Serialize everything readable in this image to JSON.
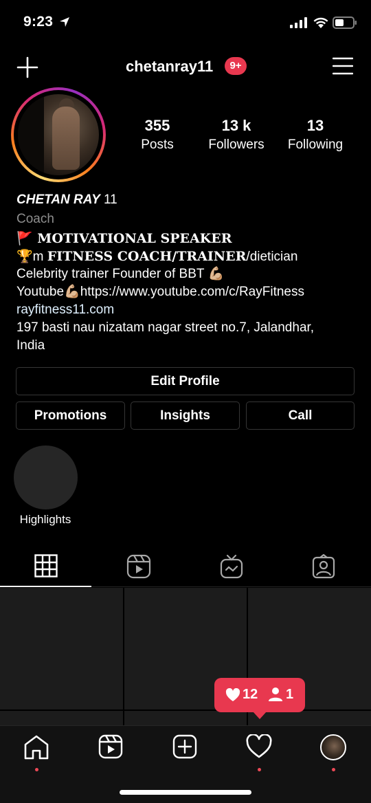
{
  "status_bar": {
    "time": "9:23"
  },
  "header": {
    "username": "chetanray11",
    "notifications": "9+"
  },
  "profile": {
    "stats": [
      {
        "value": "355",
        "label": "Posts"
      },
      {
        "value": "13 k",
        "label": "Followers"
      },
      {
        "value": "13",
        "label": "Following"
      }
    ],
    "name_italic": "CHETAN RAY",
    "name_suffix": " 11",
    "category": "Coach",
    "bio": {
      "line1_emoji": "🚩",
      "line1": " MOTIVATIONAL SPEAKER",
      "line2_emoji": "🏆",
      "line2_prefix": "m ",
      "line2_bold": "FITNESS COACH/TRAINER",
      "line2_suffix": "/dietician",
      "line3": "Celebrity trainer Founder of BBT 💪🏼",
      "line4": "Youtube💪🏼https://www.youtube.com/c/RayFitness",
      "line5": "rayfitness11.com",
      "line6": "197 basti nau nizatam nagar street no.7, Jalandhar,",
      "line7": "India"
    }
  },
  "buttons": {
    "edit_profile": "Edit Profile",
    "promotions": "Promotions",
    "insights": "Insights",
    "call": "Call"
  },
  "highlights": {
    "label": "Highlights"
  },
  "activity_popup": {
    "likes": "12",
    "follows": "1"
  },
  "colors": {
    "accent": "#e8384f",
    "button_border": "#363636",
    "muted": "#8e8e8e"
  },
  "icons": {
    "tabs": [
      "grid-icon",
      "reels-icon",
      "igtv-icon",
      "tagged-icon"
    ],
    "nav": [
      "home-icon",
      "reels-icon",
      "add-icon",
      "heart-icon",
      "profile-avatar"
    ]
  }
}
